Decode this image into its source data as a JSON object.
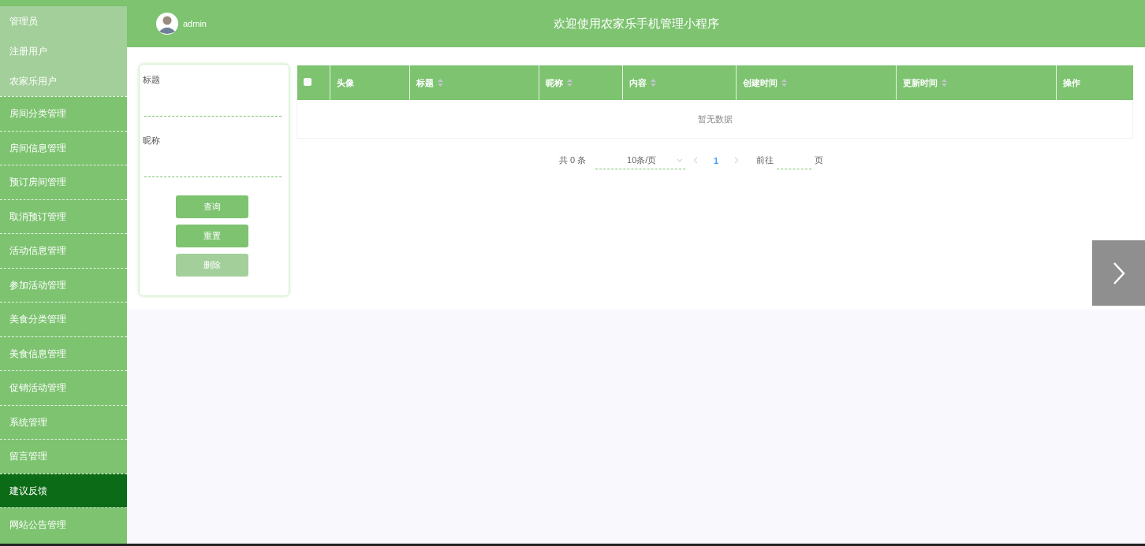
{
  "sidebar": {
    "submenu": [
      {
        "label": "管理员",
        "selected": false
      },
      {
        "label": "注册用户",
        "selected": false
      },
      {
        "label": "农家乐用户",
        "selected": false
      }
    ],
    "items": [
      {
        "label": "房间分类管理",
        "selected": false
      },
      {
        "label": "房间信息管理",
        "selected": false
      },
      {
        "label": "预订房间管理",
        "selected": false
      },
      {
        "label": "取消预订管理",
        "selected": false
      },
      {
        "label": "活动信息管理",
        "selected": false
      },
      {
        "label": "参加活动管理",
        "selected": false
      },
      {
        "label": "美食分类管理",
        "selected": false
      },
      {
        "label": "美食信息管理",
        "selected": false
      },
      {
        "label": "促销活动管理",
        "selected": false
      },
      {
        "label": "系统管理",
        "selected": false
      },
      {
        "label": "留言管理",
        "selected": false
      },
      {
        "label": "建议反馈",
        "selected": true
      },
      {
        "label": "网站公告管理",
        "selected": false
      }
    ]
  },
  "header": {
    "user": "admin",
    "title": "欢迎使用农家乐手机管理小程序"
  },
  "search": {
    "fields": [
      {
        "label": "标题"
      },
      {
        "label": "昵称"
      }
    ],
    "buttons": [
      {
        "label": "查询",
        "disabled": false
      },
      {
        "label": "重置",
        "disabled": false
      },
      {
        "label": "删除",
        "disabled": true
      }
    ]
  },
  "table": {
    "select_all": {
      "checked": false
    },
    "columns": [
      {
        "label": "头像",
        "sortable": false
      },
      {
        "label": "标题",
        "sortable": true
      },
      {
        "label": "昵称",
        "sortable": true
      },
      {
        "label": "内容",
        "sortable": true
      },
      {
        "label": "创建时间",
        "sortable": true
      },
      {
        "label": "更新时间",
        "sortable": true
      },
      {
        "label": "操作",
        "sortable": false
      }
    ],
    "empty_text": "暂无数据"
  },
  "pagination": {
    "total": "共 0 条",
    "page_size": "10条/页",
    "pages": [
      {
        "label": "1",
        "selected": true
      }
    ],
    "goto_label": "前往",
    "goto_suffix": "页"
  }
}
